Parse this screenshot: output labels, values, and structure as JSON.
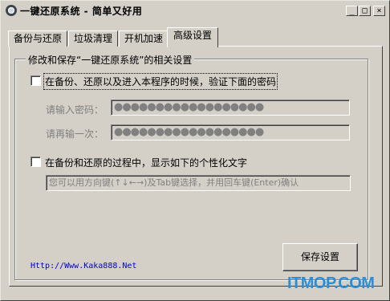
{
  "window": {
    "title": "一键还原系统 - 简单又好用",
    "controls": {
      "minimize": "_",
      "maximize": "□",
      "close": "×"
    }
  },
  "tabs": [
    "备份与还原",
    "垃圾清理",
    "开机加速",
    "高级设置"
  ],
  "active_tab": 3,
  "group": {
    "title": "修改和保存“一键还原系统”的相关设置",
    "password_check_label": "在备份、还原以及进入本程序的时候，验证下面的密码",
    "password_check_checked": false,
    "password_label": "请输入密码：",
    "password_value": "●●●●●●●●●●●●●●●●●●",
    "confirm_label": "请再输一次：",
    "confirm_value": "●●●●●●●●●●●●●●●●●●",
    "custom_text_check_label": "在备份和还原的过程中，显示如下的个性化文字",
    "custom_text_check_checked": false,
    "custom_text_value": "您可以用方向键(↑↓←→)及Tab键选择，并用回车键(Enter)确认"
  },
  "link_text": "Http://Www.Kaka888.Net",
  "save_button": "保存设置",
  "watermark": "ITMOP.COM",
  "colors": {
    "face": "#d4d0c8",
    "link": "#0000cc",
    "watermark": "#2a8fd8"
  }
}
